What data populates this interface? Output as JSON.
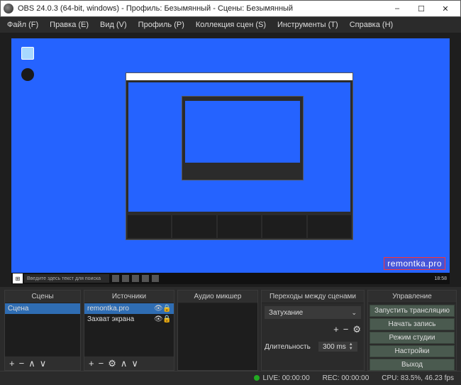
{
  "window": {
    "title": "OBS 24.0.3 (64-bit, windows) - Профиль: Безымянный - Сцены: Безымянный"
  },
  "menu": {
    "file": "Файл (F)",
    "edit": "Правка (E)",
    "view": "Вид (V)",
    "profile": "Профиль (P)",
    "scene_collection": "Коллекция сцен (S)",
    "tools": "Инструменты (T)",
    "help": "Справка (H)"
  },
  "preview": {
    "watermark": "remontka.pro",
    "taskbar_search": "Введите здесь текст для поиска",
    "taskbar_time": "18:58"
  },
  "panels": {
    "scenes_title": "Сцены",
    "sources_title": "Источники",
    "mixer_title": "Аудио микшер",
    "transitions_title": "Переходы между сценами",
    "controls_title": "Управление"
  },
  "scenes": {
    "items": [
      {
        "name": "Сцена"
      }
    ]
  },
  "sources": {
    "items": [
      {
        "name": "remontka.pro"
      },
      {
        "name": "Захват экрана"
      }
    ]
  },
  "transitions": {
    "selected": "Затухание",
    "duration_label": "Длительность",
    "duration_value": "300 ms"
  },
  "controls": {
    "start_stream": "Запустить трансляцию",
    "start_record": "Начать запись",
    "studio_mode": "Режим студии",
    "settings": "Настройки",
    "exit": "Выход"
  },
  "status": {
    "live": "LIVE: 00:00:00",
    "rec": "REC: 00:00:00",
    "cpu": "CPU: 83.5%, 46.23 fps"
  },
  "icons": {
    "plus": "+",
    "minus": "−",
    "up": "∧",
    "down": "∨",
    "gear": "⚙",
    "eye": "👁",
    "lock": "🔒",
    "caret": "⌄",
    "min": "–",
    "max": "☐",
    "close": "✕",
    "spin_up": "▲",
    "spin_down": "▼",
    "start": "⊞"
  }
}
